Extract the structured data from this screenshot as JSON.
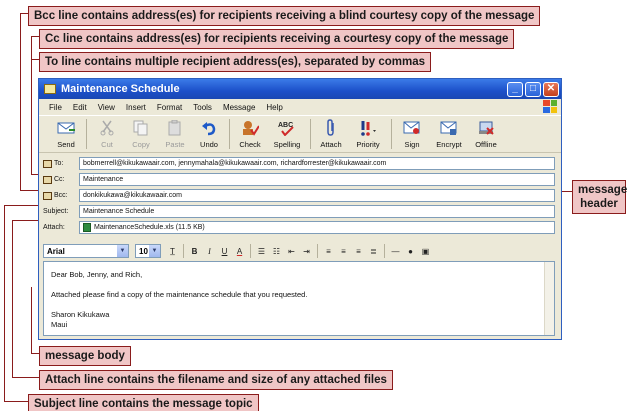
{
  "callouts": {
    "bcc": "Bcc line contains address(es) for recipients receiving a blind courtesy copy of the message",
    "cc": "Cc line contains address(es) for recipients receiving a courtesy copy of the message",
    "to": "To line contains multiple recipient address(es), separated by commas",
    "message_header": "message\nheader",
    "message_body": "message body",
    "attach": "Attach line contains the filename and size of any attached files",
    "subject": "Subject line contains the message topic"
  },
  "window": {
    "title": "Maintenance Schedule",
    "menu": [
      "File",
      "Edit",
      "View",
      "Insert",
      "Format",
      "Tools",
      "Message",
      "Help"
    ],
    "toolbar": [
      {
        "label": "Send",
        "icon": "send-icon"
      },
      {
        "label": "Cut",
        "icon": "cut-icon",
        "disabled": true
      },
      {
        "label": "Copy",
        "icon": "copy-icon",
        "disabled": true
      },
      {
        "label": "Paste",
        "icon": "paste-icon",
        "disabled": true
      },
      {
        "label": "Undo",
        "icon": "undo-icon"
      },
      {
        "label": "Check",
        "icon": "check-names-icon"
      },
      {
        "label": "Spelling",
        "icon": "spelling-icon"
      },
      {
        "label": "Attach",
        "icon": "paperclip-icon"
      },
      {
        "label": "Priority",
        "icon": "priority-icon"
      },
      {
        "label": "Sign",
        "icon": "sign-icon"
      },
      {
        "label": "Encrypt",
        "icon": "encrypt-icon"
      },
      {
        "label": "Offline",
        "icon": "offline-icon"
      }
    ]
  },
  "header": {
    "to_label": "To:",
    "to_value": "bobmerrell@kikukawaair.com, jennymahala@kikukawaair.com, richardforrester@kikukawaair.com",
    "cc_label": "Cc:",
    "cc_value": "Maintenance",
    "bcc_label": "Bcc:",
    "bcc_value": "donkikukawa@kikukawaair.com",
    "subject_label": "Subject:",
    "subject_value": "Maintenance Schedule",
    "attach_label": "Attach:",
    "attach_value": "MaintenanceSchedule.xls (11.5 KB)"
  },
  "format": {
    "font": "Arial",
    "size": "10"
  },
  "body": {
    "greeting": "Dear Bob, Jenny, and Rich,",
    "line1": "Attached please find a copy of the maintenance schedule that you requested.",
    "sign1": "Sharon Kikukawa",
    "sign2": "Maui"
  },
  "colors": {
    "callout_fill": "#f0c6c6",
    "callout_border": "#8a1c1c",
    "titlebar": "#1c50c9"
  }
}
